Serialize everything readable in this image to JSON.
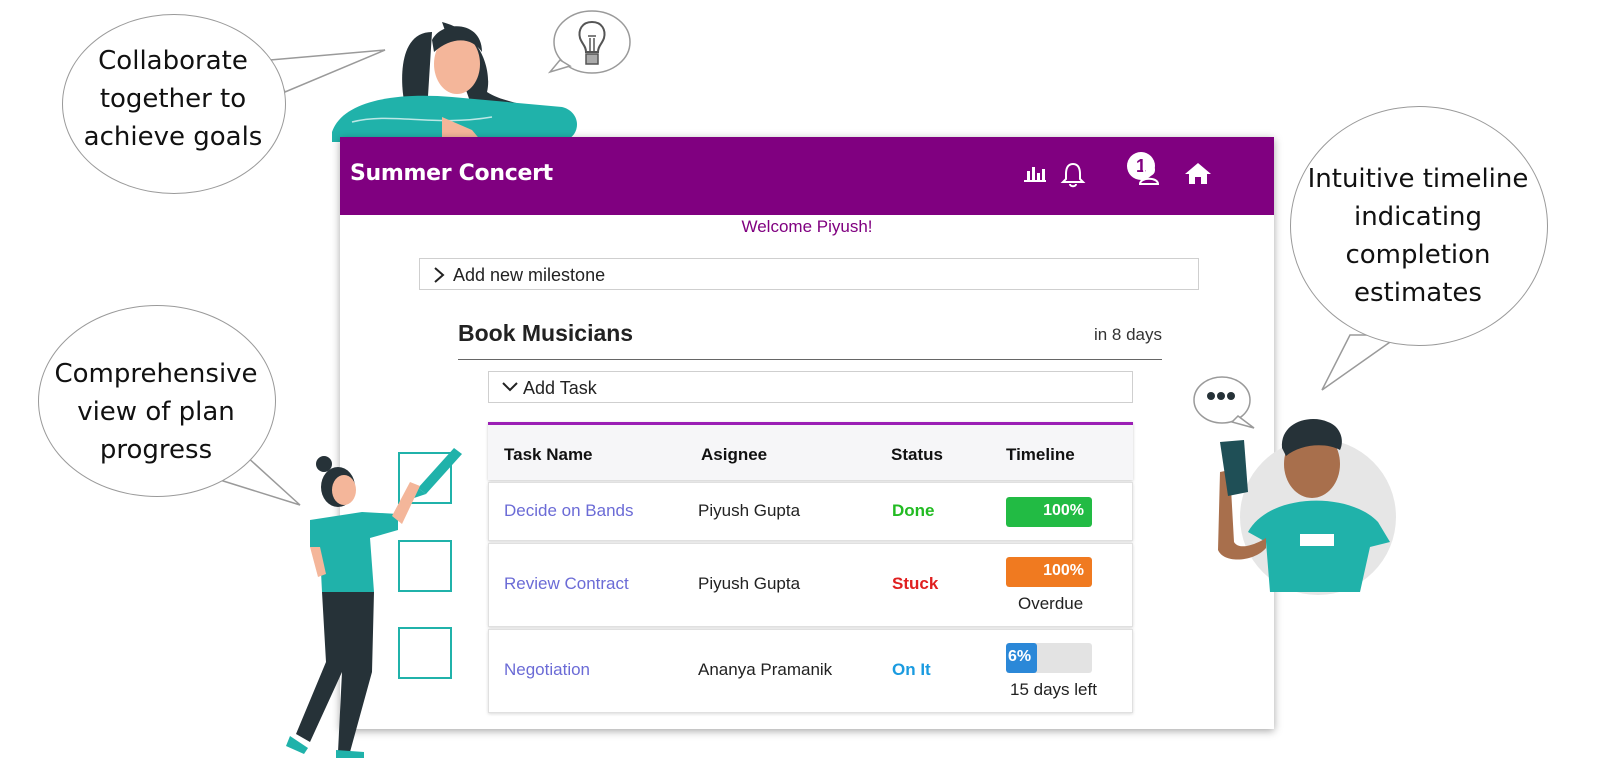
{
  "callouts": {
    "top_left": [
      "Collaborate",
      "together to",
      "achieve goals"
    ],
    "left": [
      "Comprehensive",
      "view of plan",
      "progress"
    ],
    "right": [
      "Intuitive timeline",
      "indicating",
      "completion",
      "estimates"
    ]
  },
  "app": {
    "title": "Summer Concert",
    "header_icons": [
      "chart-icon",
      "bell-icon",
      "user-icon",
      "home-icon"
    ],
    "notification_count": "1",
    "welcome": "Welcome Piyush!",
    "add_milestone_label": "Add new milestone",
    "milestone": {
      "title": "Book Musicians",
      "due": "in 8 days",
      "add_task_label": "Add Task"
    },
    "table": {
      "headers": [
        "Task Name",
        "Asignee",
        "Status",
        "Timeline"
      ],
      "rows": [
        {
          "name": "Decide on Bands",
          "assignee": "Piyush Gupta",
          "status": "Done",
          "status_color": "#22bb22",
          "progress": 100,
          "progress_label": "100%",
          "bar_color": "#22bb44",
          "note": ""
        },
        {
          "name": "Review Contract",
          "assignee": "Piyush Gupta",
          "status": "Stuck",
          "status_color": "#e02020",
          "progress": 100,
          "progress_label": "100%",
          "bar_color": "#f07a20",
          "note": "Overdue"
        },
        {
          "name": "Negotiation",
          "assignee": "Ananya Pramanik",
          "status": "On It",
          "status_color": "#1a9be0",
          "progress": 36,
          "progress_label": "6%",
          "bar_color": "#2b88d8",
          "note": "15 days left"
        }
      ]
    }
  },
  "colors": {
    "header": "#800080",
    "accent": "#9b1fb5",
    "teal": "#20b2aa"
  }
}
